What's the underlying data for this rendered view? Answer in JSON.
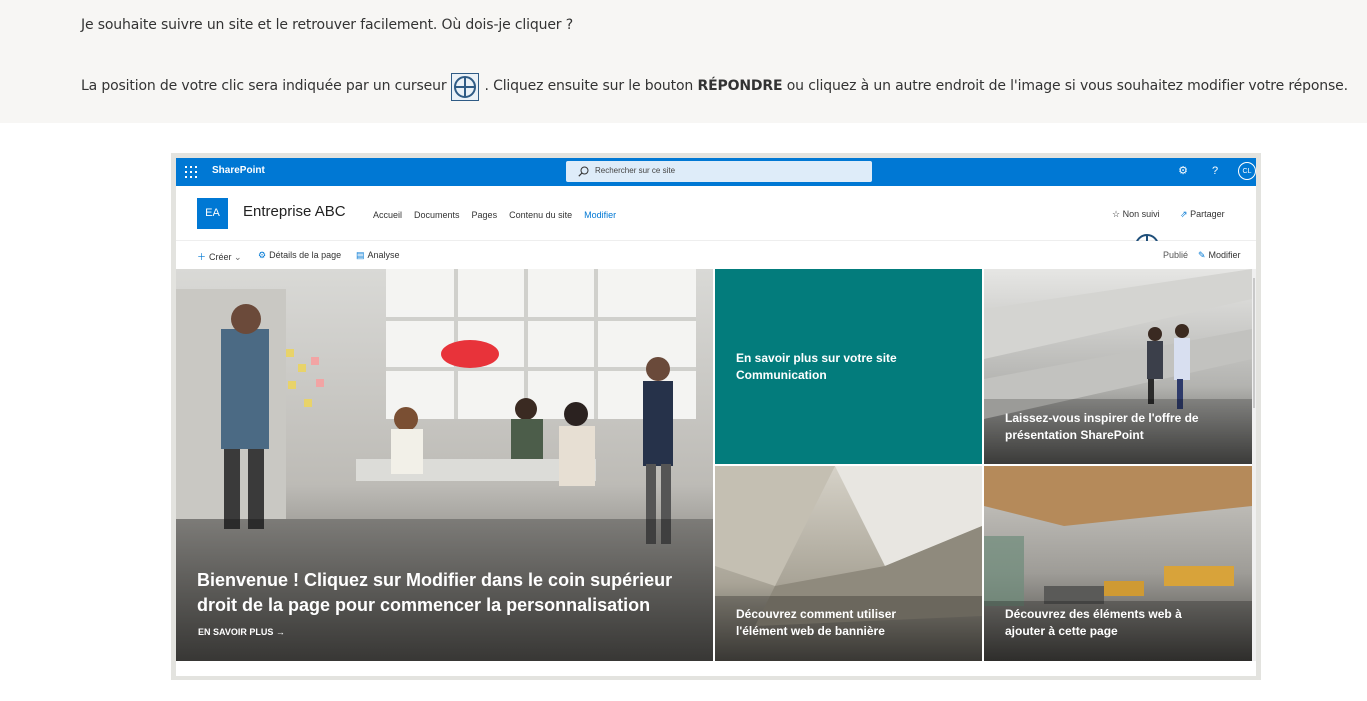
{
  "question": {
    "line1": "Je souhaite suivre un site et le retrouver facilement. Où dois-je cliquer ?",
    "line2_before": "La position de votre clic sera indiquée par un curseur",
    "line2_mid": ". Cliquez ensuite sur le bouton",
    "line2_bold": "RÉPONDRE",
    "line2_after": "ou cliquez à un autre endroit de l'image si vous souhaitez modifier votre réponse."
  },
  "suitebar": {
    "app_name": "SharePoint",
    "search_placeholder": "Rechercher sur ce site",
    "help": "?",
    "avatar_initials": "CL",
    "color": "#0078d4"
  },
  "site": {
    "logo_initials": "EA",
    "title": "Entreprise ABC",
    "nav": [
      "Accueil",
      "Documents",
      "Pages",
      "Contenu du site",
      "Modifier"
    ],
    "follow_label": "Non suivi",
    "share_label": "Partager"
  },
  "commands": {
    "create": "Créer",
    "page_details": "Détails de la page",
    "analytics": "Analyse",
    "published": "Publié",
    "edit": "Modifier"
  },
  "hero": {
    "main_title": "Bienvenue ! Cliquez sur Modifier dans le coin supérieur droit de la page pour commencer la personnalisation",
    "main_link": "EN SAVOIR PLUS",
    "tile_teal": "En savoir plus sur votre site Communication",
    "tile_top_right": "Laissez-vous inspirer de l'offre de présentation SharePoint",
    "tile_bottom_middle": "Découvrez comment utiliser l'élément web de bannière",
    "tile_bottom_right": "Découvrez des éléments web à ajouter à cette page"
  }
}
